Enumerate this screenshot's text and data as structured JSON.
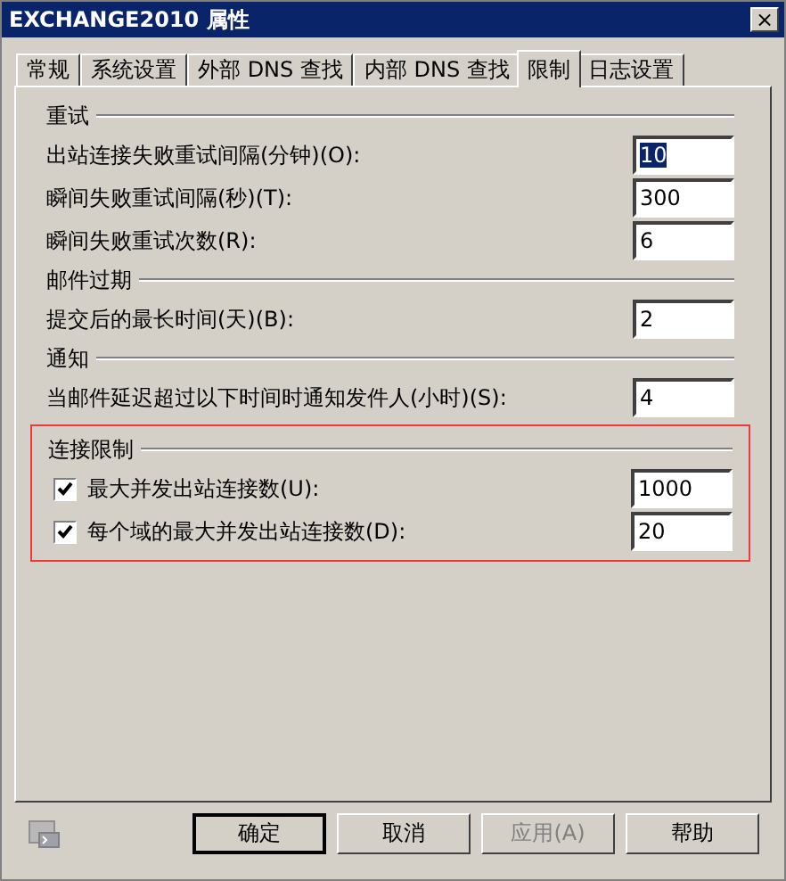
{
  "window": {
    "title": "EXCHANGE2010 属性",
    "close": "×"
  },
  "tabs": [
    {
      "label": "常规",
      "selected": false
    },
    {
      "label": "系统设置",
      "selected": false
    },
    {
      "label": "外部 DNS 查找",
      "selected": false
    },
    {
      "label": "内部 DNS 查找",
      "selected": false
    },
    {
      "label": "限制",
      "selected": true
    },
    {
      "label": "日志设置",
      "selected": false
    }
  ],
  "sections": [
    {
      "title": "重试",
      "highlighted": false,
      "rows": [
        {
          "kind": "field",
          "label": "出站连接失败重试间隔(分钟)(O):",
          "value": "10",
          "value_selected": true
        },
        {
          "kind": "field",
          "label": "瞬间失败重试间隔(秒)(T):",
          "value": "300",
          "value_selected": false
        },
        {
          "kind": "field",
          "label": "瞬间失败重试次数(R):",
          "value": "6",
          "value_selected": false
        }
      ]
    },
    {
      "title": "邮件过期",
      "highlighted": false,
      "rows": [
        {
          "kind": "field",
          "label": "提交后的最长时间(天)(B):",
          "value": "2",
          "value_selected": false
        }
      ]
    },
    {
      "title": "通知",
      "highlighted": false,
      "rows": [
        {
          "kind": "field",
          "label": "当邮件延迟超过以下时间时通知发件人(小时)(S):",
          "value": "4",
          "value_selected": false
        }
      ]
    },
    {
      "title": "连接限制",
      "highlighted": true,
      "rows": [
        {
          "kind": "checkbox",
          "label": "最大并发出站连接数(U):",
          "checked": true,
          "value": "1000",
          "value_selected": false
        },
        {
          "kind": "checkbox",
          "label": "每个域的最大并发出站连接数(D):",
          "checked": true,
          "value": "20",
          "value_selected": false
        }
      ]
    }
  ],
  "buttons": [
    {
      "label": "确定",
      "default": true,
      "disabled": false
    },
    {
      "label": "取消",
      "default": false,
      "disabled": false
    },
    {
      "label": "应用(A)",
      "default": false,
      "disabled": true
    },
    {
      "label": "帮助",
      "default": false,
      "disabled": false
    }
  ]
}
